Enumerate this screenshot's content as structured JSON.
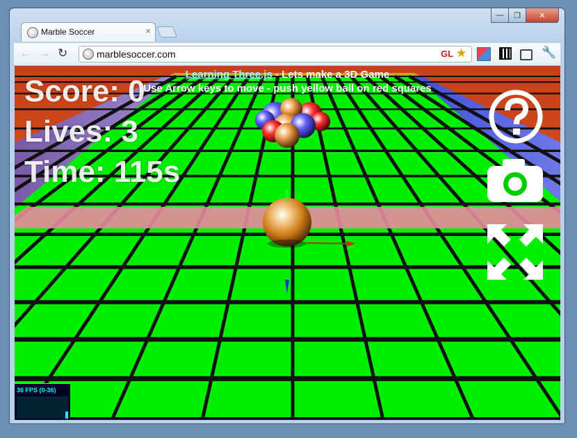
{
  "browser": {
    "tab_title": "Marble Soccer",
    "tab_close": "×",
    "url": "marblesoccer.com",
    "gl_badge": "GL",
    "window_min": "—",
    "window_max": "❐",
    "window_close": "✕",
    "back_glyph": "←",
    "forward_glyph": "→",
    "reload_glyph": "↻",
    "star_glyph": "★",
    "wrench_glyph": "🔧"
  },
  "game": {
    "score_label": "Score: 0",
    "lives_label": "Lives: 3",
    "time_label": "Time: 115s",
    "info_link": "Learning Three.js",
    "info_title_rest": " - Lets make a 3D Game",
    "info_instructions": "Use Arrow keys to move - push yellow ball on red squares",
    "fps_label": "36 FPS (0-36)",
    "icons": [
      "help-icon",
      "camera-icon",
      "fullscreen-icon"
    ]
  }
}
